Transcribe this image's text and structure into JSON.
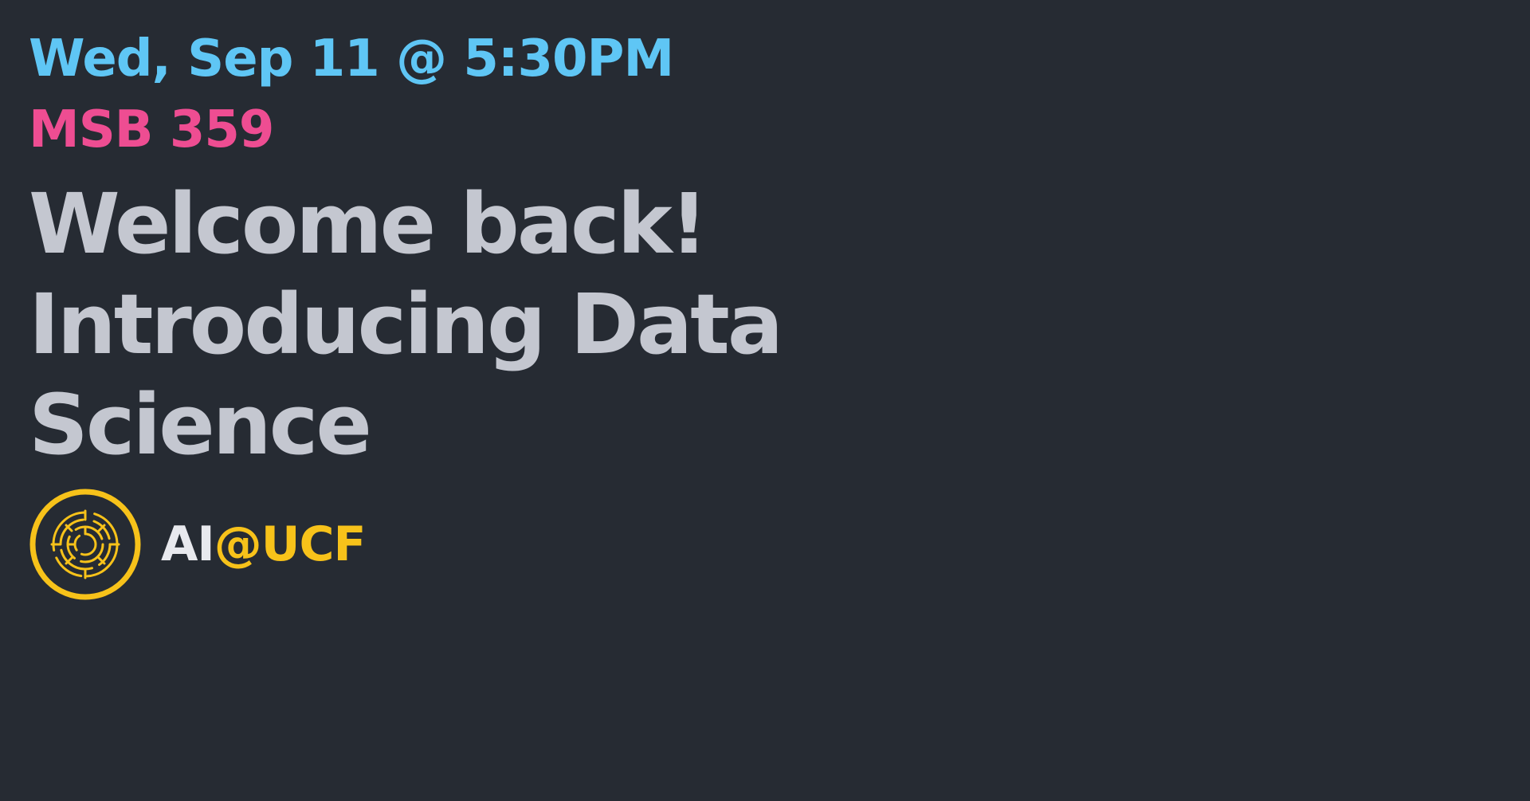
{
  "event": {
    "datetime": "Wed, Sep 11 @ 5:30PM",
    "location": "MSB 359",
    "title_lines": [
      "Welcome back!",
      "Introducing Data",
      "Science"
    ]
  },
  "brand": {
    "name_prefix": "AI",
    "name_suffix": "@UCF",
    "logo_icon": "circuit-circle-icon"
  },
  "colors": {
    "background": "#262b33",
    "datetime": "#5fc6f5",
    "location": "#ee4d92",
    "title": "#c4c7d0",
    "brand_accent": "#f7c21a"
  }
}
